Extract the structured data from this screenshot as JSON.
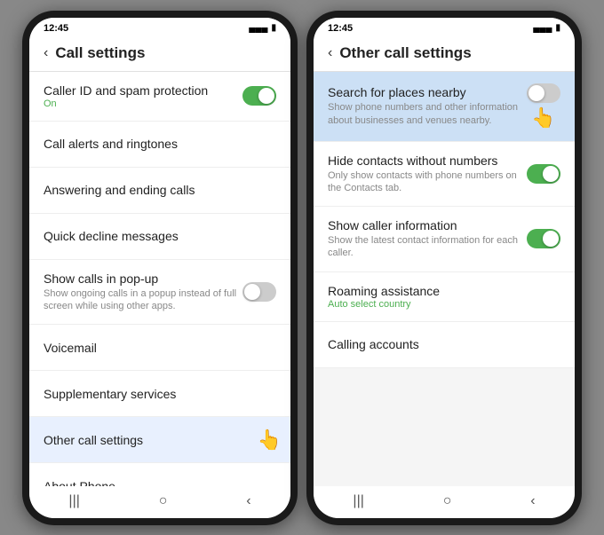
{
  "left_phone": {
    "status_time": "12:45",
    "header_title": "Call settings",
    "items": [
      {
        "label": "Caller ID and spam protection",
        "sub": "On",
        "type": "toggle",
        "toggle_on": true
      },
      {
        "label": "Call alerts and ringtones",
        "type": "nav"
      },
      {
        "label": "Answering and ending calls",
        "type": "nav"
      },
      {
        "label": "Quick decline messages",
        "type": "nav"
      },
      {
        "label": "Show calls in pop-up",
        "desc": "Show ongoing calls in a popup instead of full screen while using other apps.",
        "type": "toggle",
        "toggle_on": false
      },
      {
        "label": "Voicemail",
        "type": "nav"
      },
      {
        "label": "Supplementary services",
        "type": "nav"
      },
      {
        "label": "Other call settings",
        "type": "nav",
        "highlighted": true
      },
      {
        "label": "About Phone",
        "type": "nav"
      }
    ]
  },
  "right_phone": {
    "status_time": "12:45",
    "header_title": "Other call settings",
    "items": [
      {
        "label": "Search for places nearby",
        "desc": "Show phone numbers and other information about businesses and venues nearby.",
        "type": "toggle",
        "toggle_on": false,
        "highlighted": true
      },
      {
        "label": "Hide contacts without numbers",
        "desc": "Only show contacts with phone numbers on the Contacts tab.",
        "type": "toggle",
        "toggle_on": true
      },
      {
        "label": "Show caller information",
        "desc": "Show the latest contact information for each caller.",
        "type": "toggle",
        "toggle_on": true
      },
      {
        "label": "Roaming assistance",
        "sub": "Auto select country",
        "type": "nav"
      },
      {
        "label": "Calling accounts",
        "type": "nav"
      }
    ]
  },
  "icons": {
    "back": "‹",
    "menu": "|||",
    "home": "○",
    "back_nav": "‹",
    "signal": "▄▄▄",
    "battery": "▮"
  }
}
